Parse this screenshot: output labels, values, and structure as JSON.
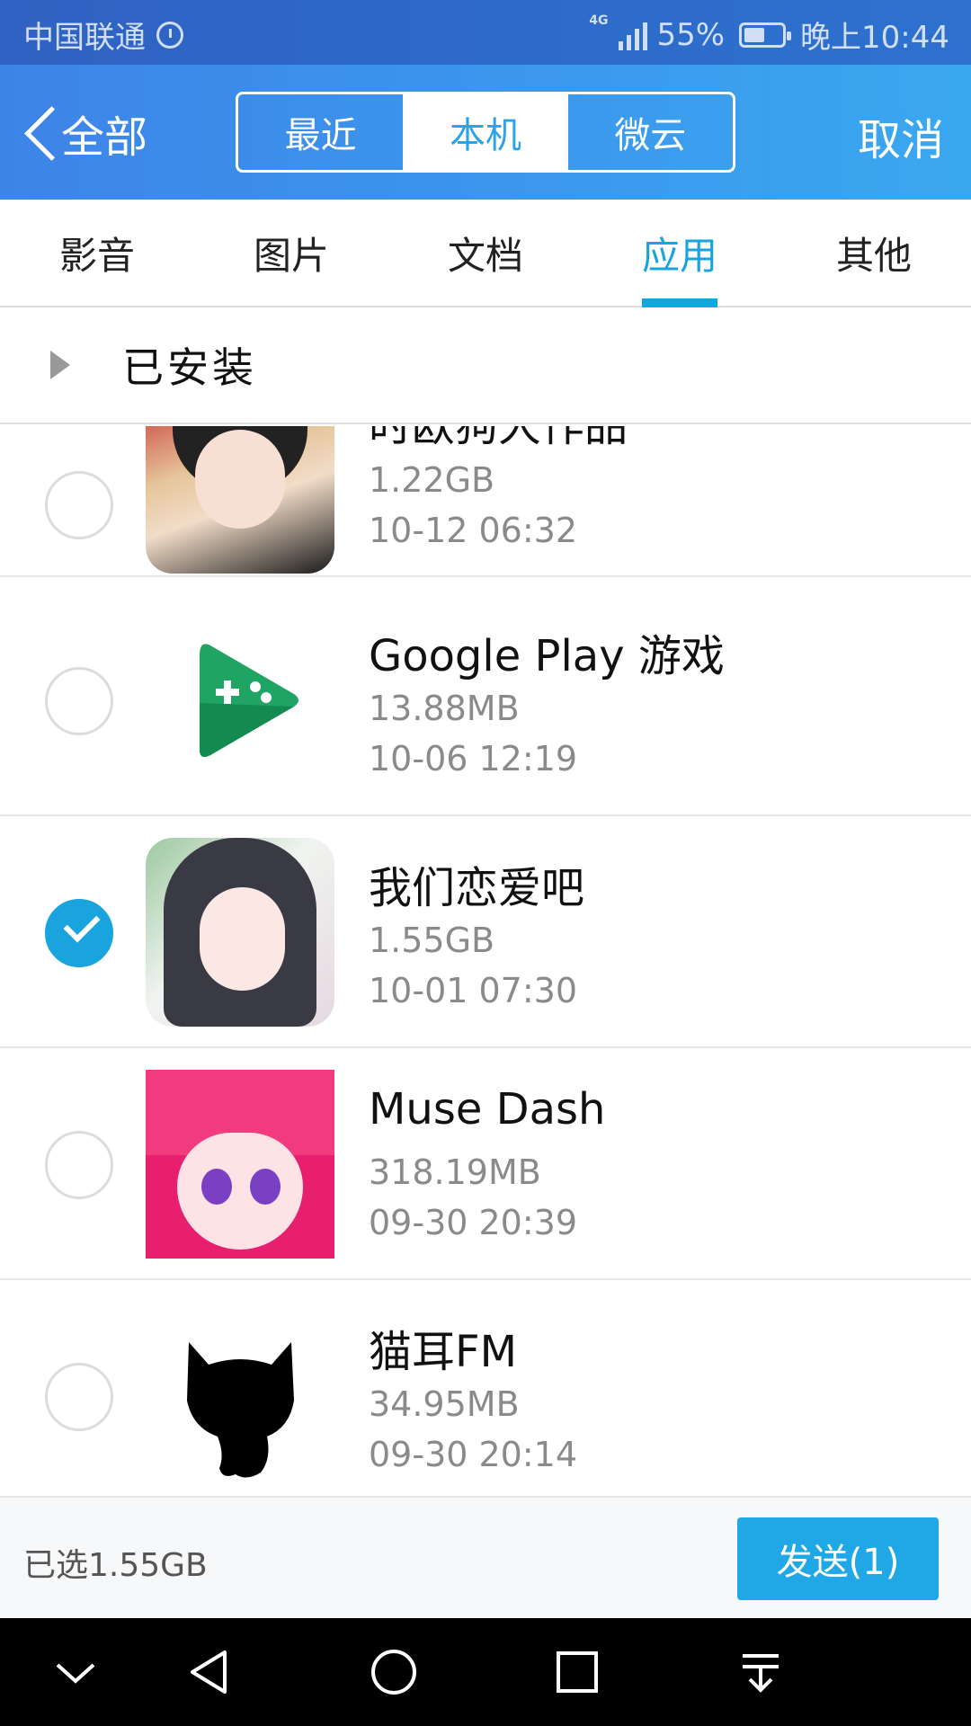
{
  "status_bar": {
    "carrier": "中国联通",
    "network": "4G",
    "battery": "55%",
    "battery_level": 0.55,
    "time": "晚上10:44",
    "icons": [
      "alarm-icon",
      "signal-icon",
      "battery-icon"
    ]
  },
  "header": {
    "back_label": "全部",
    "segments": [
      {
        "label": "最近",
        "active": false
      },
      {
        "label": "本机",
        "active": true
      },
      {
        "label": "微云",
        "active": false
      }
    ],
    "cancel_label": "取消"
  },
  "tabs": [
    {
      "label": "影音",
      "active": false
    },
    {
      "label": "图片",
      "active": false
    },
    {
      "label": "文档",
      "active": false
    },
    {
      "label": "应用",
      "active": true
    },
    {
      "label": "其他",
      "active": false
    }
  ],
  "group": {
    "label": "已安装"
  },
  "apps": [
    {
      "name": "时欧狗大作品",
      "size": "1.22GB",
      "date": "10-12 06:32",
      "checked": false,
      "icon": "anime-girl-red-icon"
    },
    {
      "name": "Google Play 游戏",
      "size": "13.88MB",
      "date": "10-06 12:19",
      "checked": false,
      "icon": "google-play-games-icon"
    },
    {
      "name": "我们恋爱吧",
      "size": "1.55GB",
      "date": "10-01 07:30",
      "checked": true,
      "icon": "anime-girl-dark-hair-icon"
    },
    {
      "name": "Muse Dash",
      "size": "318.19MB",
      "date": "09-30 20:39",
      "checked": false,
      "icon": "muse-dash-icon"
    },
    {
      "name": "猫耳FM",
      "size": "34.95MB",
      "date": "09-30 20:14",
      "checked": false,
      "icon": "cat-silhouette-icon"
    }
  ],
  "footer": {
    "selected_text": "已选1.55GB",
    "send_label": "发送(1)"
  },
  "colors": {
    "accent": "#1aa4de",
    "header_start": "#3d84e8",
    "header_end": "#3aa8f0",
    "send_button": "#20a7e6"
  }
}
